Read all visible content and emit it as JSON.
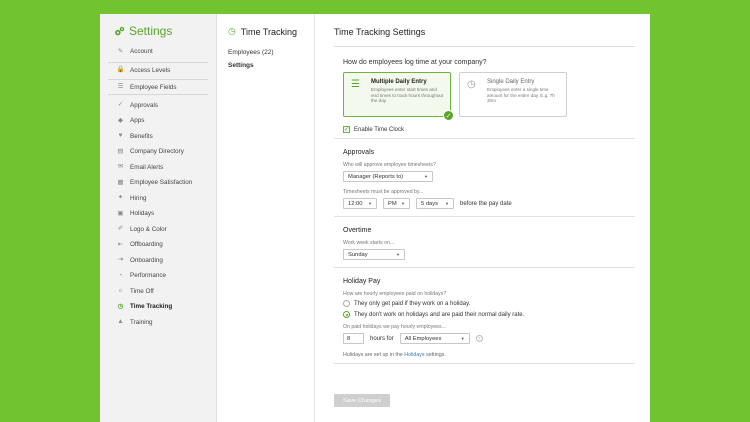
{
  "sidebar": {
    "title": "Settings",
    "items": [
      {
        "label": "Account",
        "icon": "wrench-icon",
        "glyph": "✎"
      },
      {
        "label": "Access Levels",
        "icon": "lock-icon",
        "glyph": "🔒"
      },
      {
        "label": "Employee Fields",
        "icon": "list-icon",
        "glyph": "☰"
      },
      {
        "label": "Approvals",
        "icon": "thumbs-up-icon",
        "glyph": "✓"
      },
      {
        "label": "Apps",
        "icon": "apps-icon",
        "glyph": "◆"
      },
      {
        "label": "Benefits",
        "icon": "heart-icon",
        "glyph": "♥"
      },
      {
        "label": "Company Directory",
        "icon": "directory-icon",
        "glyph": "▤"
      },
      {
        "label": "Email Alerts",
        "icon": "email-icon",
        "glyph": "✉"
      },
      {
        "label": "Employee Satisfaction",
        "icon": "chart-icon",
        "glyph": "▦"
      },
      {
        "label": "Hiring",
        "icon": "hiring-icon",
        "glyph": "✦"
      },
      {
        "label": "Holidays",
        "icon": "calendar-icon",
        "glyph": "▣"
      },
      {
        "label": "Logo & Color",
        "icon": "paint-icon",
        "glyph": "✐"
      },
      {
        "label": "Offboarding",
        "icon": "offboarding-icon",
        "glyph": "⇤"
      },
      {
        "label": "Onboarding",
        "icon": "onboarding-icon",
        "glyph": "⇥"
      },
      {
        "label": "Performance",
        "icon": "gauge-icon",
        "glyph": "◔"
      },
      {
        "label": "Time Off",
        "icon": "time-off-icon",
        "glyph": "☼"
      },
      {
        "label": "Time Tracking",
        "icon": "stopwatch-icon",
        "glyph": "◷"
      },
      {
        "label": "Training",
        "icon": "training-icon",
        "glyph": "▲"
      }
    ]
  },
  "subnav": {
    "title": "Time Tracking",
    "links": [
      "Employees (22)",
      "Settings"
    ]
  },
  "main": {
    "title": "Time Tracking Settings",
    "question": "How do employees log time at your company?",
    "options": [
      {
        "title": "Multiple Daily Entry",
        "desc": "Employees enter start times and end times to track hours throughout the day."
      },
      {
        "title": "Single Daily Entry",
        "desc": "Employees enter a single time amount for the entire day. E.g. 7h 30m"
      }
    ],
    "enable_time_clock": "Enable Time Clock",
    "approvals": {
      "heading": "Approvals",
      "who_label": "Who will approve employee timesheets?",
      "who_value": "Manager (Reports to)",
      "approved_by_label": "Timesheets must be approved by...",
      "time_value": "12:00",
      "ampm_value": "PM",
      "days_value": "5 days",
      "suffix": "before the pay date"
    },
    "overtime": {
      "heading": "Overtime",
      "week_label": "Work week starts on...",
      "week_value": "Sunday"
    },
    "holiday_pay": {
      "heading": "Holiday Pay",
      "question": "How are hourly employees paid on holidays?",
      "radio1": "They only get paid if they work on a holiday.",
      "radio2": "They don't work on holidays and are paid their normal daily rate.",
      "hours_label": "On paid holidays we pay hourly employees...",
      "hours_value": "8",
      "hours_for": "hours for",
      "employees_value": "All Employees",
      "note_before": "Holidays are set up in the",
      "note_link": "Holidays",
      "note_after": "settings."
    },
    "save_label": "Save Changes"
  },
  "colors": {
    "background": "#71c42f",
    "accent": "#5aa32b",
    "link": "#3a79c1"
  }
}
